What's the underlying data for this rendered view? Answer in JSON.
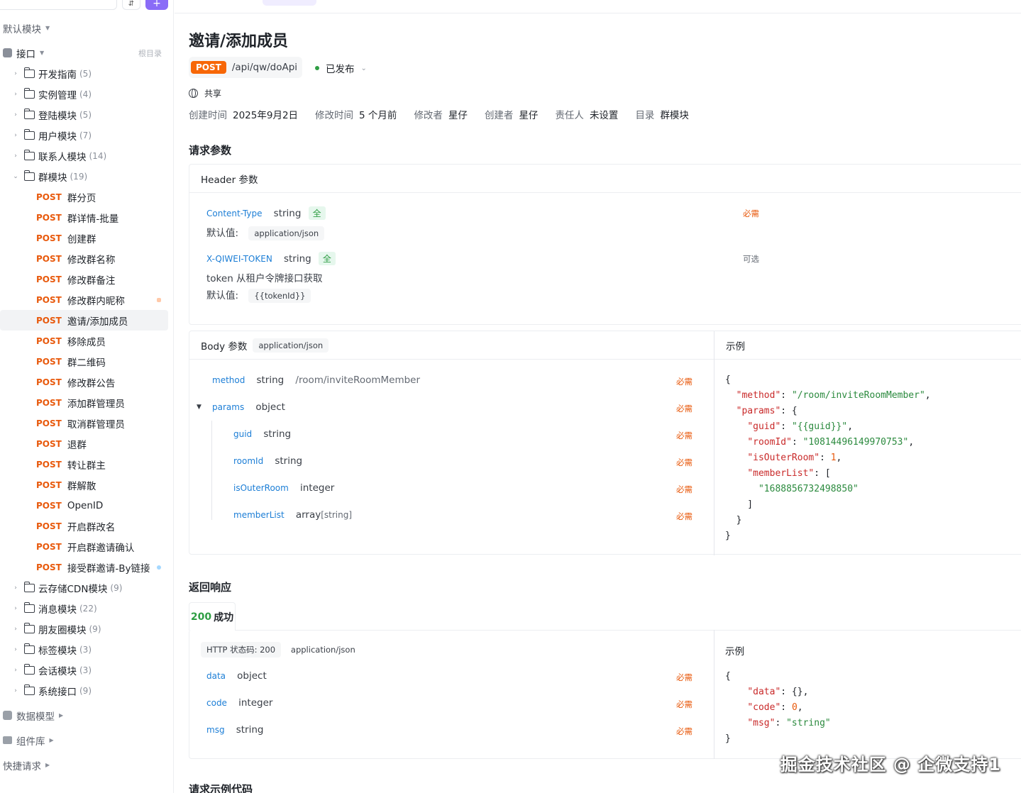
{
  "sidebar": {
    "default_module": "默认模块",
    "api_root": {
      "label": "接口",
      "root_hint": "根目录"
    },
    "folders_top": [
      {
        "name": "开发指南",
        "count": "(5)"
      },
      {
        "name": "实例管理",
        "count": "(4)"
      },
      {
        "name": "登陆模块",
        "count": "(5)"
      },
      {
        "name": "用户模块",
        "count": "(7)"
      },
      {
        "name": "联系人模块",
        "count": "(14)"
      },
      {
        "name": "群模块",
        "count": "(19)"
      }
    ],
    "method": "POST",
    "group_items": [
      "群分页",
      "群详情-批量",
      "创建群",
      "修改群名称",
      "修改群备注",
      "修改群内昵称",
      "邀请/添加成员",
      "移除成员",
      "群二维码",
      "修改群公告",
      "添加群管理员",
      "取消群管理员",
      "退群",
      "转让群主",
      "群解散",
      "OpenID",
      "开启群改名",
      "开启群邀请确认",
      "接受群邀请-By链接"
    ],
    "folders_bottom": [
      {
        "name": "云存储CDN模块",
        "count": "(9)"
      },
      {
        "name": "消息模块",
        "count": "(22)"
      },
      {
        "name": "朋友圈模块",
        "count": "(9)"
      },
      {
        "name": "标签模块",
        "count": "(3)"
      },
      {
        "name": "会话模块",
        "count": "(3)"
      },
      {
        "name": "系统接口",
        "count": "(9)"
      }
    ],
    "data_model": "数据模型",
    "component_lib": "组件库",
    "quick_request": "快捷请求"
  },
  "page": {
    "title": "邀请/添加成员",
    "method": "POST",
    "path": "/api/qw/doApi",
    "status": "已发布",
    "share": "共享",
    "meta": [
      {
        "k": "创建时间",
        "v": "2025年9月2日"
      },
      {
        "k": "修改时间",
        "v": "5 个月前"
      },
      {
        "k": "修改者",
        "v": "星仔"
      },
      {
        "k": "创建者",
        "v": "星仔"
      },
      {
        "k": "责任人",
        "v": "未设置"
      },
      {
        "k": "目录",
        "v": "群模块"
      }
    ]
  },
  "request": {
    "title": "请求参数",
    "header_title": "Header 参数",
    "headers": [
      {
        "name": "Content-Type",
        "type": "string",
        "tag": "全",
        "required": "必需",
        "default_label": "默认值:",
        "default": "application/json"
      },
      {
        "name": "X-QIWEI-TOKEN",
        "type": "string",
        "tag": "全",
        "required": "可选",
        "desc": "token 从租户令牌接口获取",
        "default_label": "默认值:",
        "default": "{{tokenId}}"
      }
    ],
    "body_title": "Body 参数",
    "body_type": "application/json",
    "example_label": "示例",
    "body_params": [
      {
        "name": "method",
        "type": "string",
        "extra": "/room/inviteRoomMember",
        "required": "必需"
      },
      {
        "name": "params",
        "type": "object",
        "required": "必需"
      },
      {
        "name": "guid",
        "type": "string",
        "required": "必需"
      },
      {
        "name": "roomId",
        "type": "string",
        "required": "必需"
      },
      {
        "name": "isOuterRoom",
        "type": "integer",
        "required": "必需"
      },
      {
        "name": "memberList",
        "type": "array",
        "type_sub": "[string]",
        "required": "必需"
      }
    ],
    "example": {
      "method": "/room/inviteRoomMember",
      "guid": "{{guid}}",
      "roomId": "10814496149970753",
      "isOuterRoom": "1",
      "member": "1688856732498850"
    }
  },
  "response": {
    "title": "返回响应",
    "tab": "200 成功",
    "tab_code": "200",
    "tab_text": "成功",
    "http_status": "HTTP 状态码: 200",
    "content_type": "application/json",
    "example_label": "示例",
    "params": [
      {
        "name": "data",
        "type": "object",
        "required": "必需"
      },
      {
        "name": "code",
        "type": "integer",
        "required": "必需"
      },
      {
        "name": "msg",
        "type": "string",
        "required": "必需"
      }
    ]
  },
  "next_section": "请求示例代码",
  "watermark": "掘金技术社区 @ 企微支持1",
  "colors": {
    "accent": "#8a6cf7",
    "post": "#f76707",
    "required": "#e8590c",
    "link": "#1c7ed6",
    "green": "#2f9e44"
  }
}
